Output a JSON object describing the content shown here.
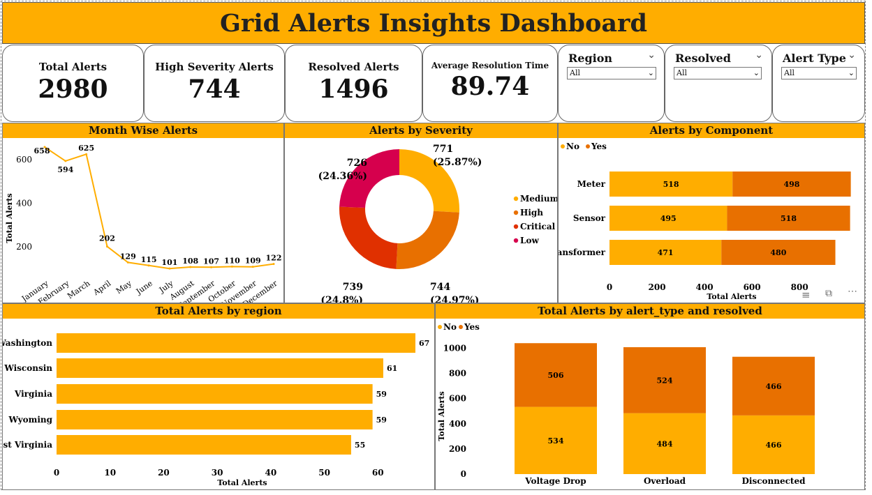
{
  "title": "Grid Alerts Insights Dashboard",
  "kpis": {
    "total": {
      "label": "Total Alerts",
      "value": "2980"
    },
    "high": {
      "label": "High Severity Alerts",
      "value": "744"
    },
    "resolved": {
      "label": "Resolved Alerts",
      "value": "1496"
    },
    "avg": {
      "label": "Average Resolution Time",
      "value": "89.74"
    }
  },
  "slicers": {
    "region": {
      "label": "Region",
      "value": "All"
    },
    "resolved": {
      "label": "Resolved",
      "value": "All"
    },
    "alert_type": {
      "label": "Alert Type",
      "value": "All"
    }
  },
  "colors": {
    "accent": "#FFAD00",
    "no": "#FFAD00",
    "yes": "#E87000",
    "medium": "#FFAD00",
    "high": "#E87000",
    "critical": "#E03000",
    "low": "#D6004D"
  },
  "chart_data": [
    {
      "id": "month",
      "type": "line",
      "title": "Month Wise Alerts",
      "ylabel": "Total Alerts",
      "xlabel": "",
      "categories": [
        "January",
        "February",
        "March",
        "April",
        "May",
        "June",
        "July",
        "August",
        "September",
        "October",
        "November",
        "December"
      ],
      "values": [
        658,
        594,
        625,
        202,
        129,
        115,
        101,
        108,
        107,
        110,
        109,
        122
      ],
      "yticks": [
        200,
        400,
        600
      ],
      "ylim": [
        60,
        680
      ]
    },
    {
      "id": "severity",
      "type": "pie",
      "title": "Alerts by Severity",
      "slices": [
        {
          "name": "Medium",
          "value": 771,
          "pct": "(25.87%)"
        },
        {
          "name": "High",
          "value": 744,
          "pct": "(24.97%)"
        },
        {
          "name": "Critical",
          "value": 739,
          "pct": "(24.8%)"
        },
        {
          "name": "Low",
          "value": 726,
          "pct": "(24.36%)"
        }
      ]
    },
    {
      "id": "component",
      "type": "bar",
      "title": "Alerts by Component",
      "orientation": "horizontal",
      "stacked": true,
      "legend": [
        "No",
        "Yes"
      ],
      "categories": [
        "Meter",
        "Sensor",
        "Transformer"
      ],
      "series": [
        {
          "name": "No",
          "values": [
            518,
            495,
            471
          ]
        },
        {
          "name": "Yes",
          "values": [
            498,
            518,
            480
          ]
        }
      ],
      "xlabel": "Total Alerts",
      "xticks": [
        0,
        200,
        400,
        600,
        800
      ],
      "xlim": [
        0,
        1020
      ]
    },
    {
      "id": "region",
      "type": "bar",
      "title": "Total Alerts by region",
      "orientation": "horizontal",
      "categories": [
        "Washington",
        "Wisconsin",
        "Virginia",
        "Wyoming",
        "West Virginia"
      ],
      "values": [
        67,
        61,
        59,
        59,
        55
      ],
      "xlabel": "Total Alerts",
      "xticks": [
        0,
        10,
        20,
        30,
        40,
        50,
        60
      ],
      "xlim": [
        0,
        70
      ]
    },
    {
      "id": "alerttype",
      "type": "bar",
      "title": "Total Alerts by alert_type and resolved",
      "stacked": true,
      "legend": [
        "No",
        "Yes"
      ],
      "categories": [
        "Voltage Drop",
        "Overload",
        "Disconnected"
      ],
      "series": [
        {
          "name": "No",
          "values": [
            534,
            484,
            466
          ]
        },
        {
          "name": "Yes",
          "values": [
            506,
            524,
            466
          ]
        }
      ],
      "ylabel": "Total Alerts",
      "yticks": [
        0,
        200,
        400,
        600,
        800,
        1000
      ],
      "ylim": [
        0,
        1080
      ]
    }
  ]
}
